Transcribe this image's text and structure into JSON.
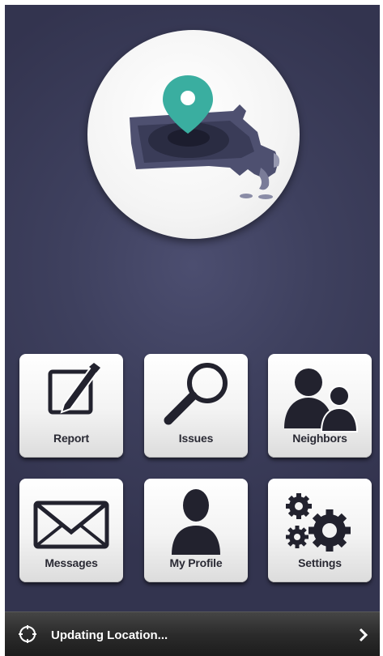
{
  "logo": {
    "icon": "massachusetts-map-pin-icon"
  },
  "tiles": [
    {
      "label": "Report",
      "icon": "pencil-edit-icon"
    },
    {
      "label": "Issues",
      "icon": "magnifier-icon"
    },
    {
      "label": "Neighbors",
      "icon": "neighbors-icon"
    },
    {
      "label": "Messages",
      "icon": "envelope-icon"
    },
    {
      "label": "My Profile",
      "icon": "person-icon"
    },
    {
      "label": "Settings",
      "icon": "gears-icon"
    }
  ],
  "status": {
    "text": "Updating Location...",
    "icon": "location-target-icon"
  },
  "colors": {
    "background": "#3e405e",
    "pin": "#3aaea0",
    "icon": "#22222e",
    "status_bar": "#2b2b2b"
  }
}
